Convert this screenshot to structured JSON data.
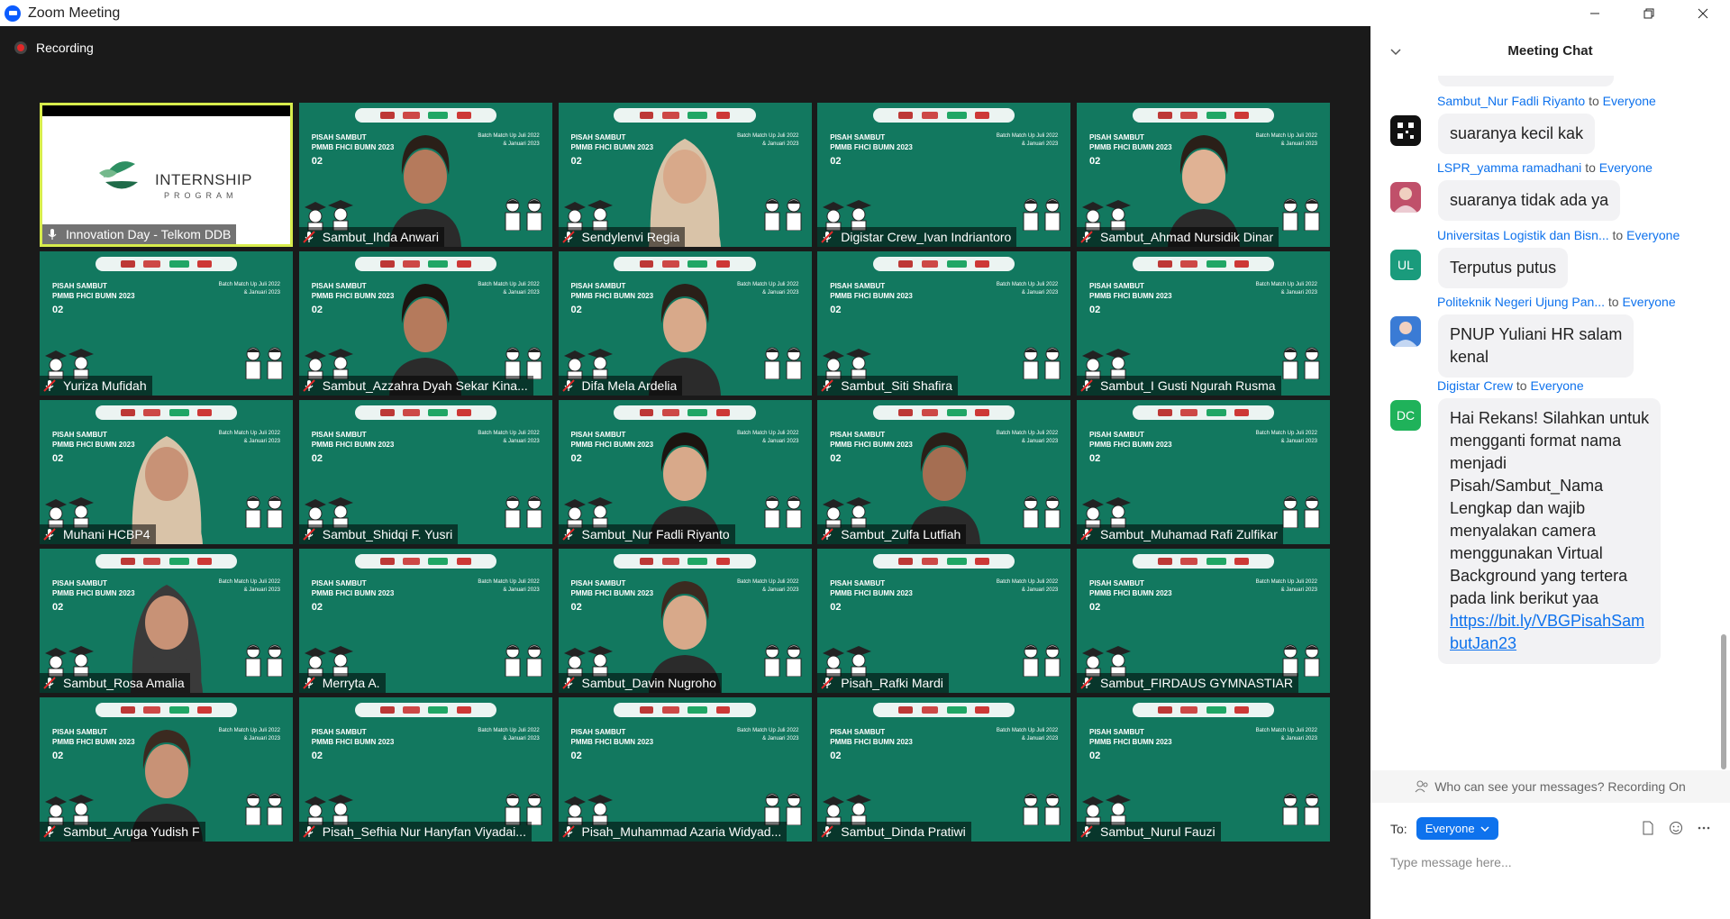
{
  "window": {
    "title": "Zoom Meeting"
  },
  "stage": {
    "recording_label": "Recording"
  },
  "tile_text": {
    "headline": "PISAH SAMBUT\nPMMB FHCI BUMN 2023",
    "batch": "Batch Match Up Juli 2022\n& Januari 2023",
    "date": "02"
  },
  "participants": [
    {
      "name": "Innovation Day - Telkom DDB",
      "type": "slide",
      "active": true,
      "mic": "unmuted"
    },
    {
      "name": "Sambut_Ihda Anwari",
      "type": "person",
      "mic": "muted"
    },
    {
      "name": "Sendylenvi Regia",
      "type": "person",
      "mic": "muted"
    },
    {
      "name": "Digistar Crew_Ivan Indriantoro",
      "type": "background",
      "mic": "muted"
    },
    {
      "name": "Sambut_Ahmad Nursidik Dinar",
      "type": "person",
      "mic": "muted"
    },
    {
      "name": "Yuriza Mufidah",
      "type": "background",
      "mic": "muted"
    },
    {
      "name": "Sambut_Azzahra Dyah Sekar Kina...",
      "type": "person",
      "mic": "muted"
    },
    {
      "name": "Difa Mela Ardelia",
      "type": "person",
      "mic": "muted"
    },
    {
      "name": "Sambut_Siti Shafira",
      "type": "background",
      "mic": "muted"
    },
    {
      "name": "Sambut_I Gusti Ngurah Rusma",
      "type": "background",
      "mic": "muted"
    },
    {
      "name": "Muhani HCBP4",
      "type": "person",
      "mic": "muted"
    },
    {
      "name": "Sambut_Shidqi F. Yusri",
      "type": "background",
      "mic": "muted"
    },
    {
      "name": "Sambut_Nur Fadli Riyanto",
      "type": "person",
      "mic": "muted"
    },
    {
      "name": "Sambut_Zulfa Lutfiah",
      "type": "person",
      "mic": "muted"
    },
    {
      "name": "Sambut_Muhamad Rafi Zulfikar",
      "type": "background",
      "mic": "muted"
    },
    {
      "name": "Sambut_Rosa Amalia",
      "type": "person",
      "mic": "muted"
    },
    {
      "name": "Merryta A.",
      "type": "background",
      "mic": "muted"
    },
    {
      "name": "Sambut_Davin Nugroho",
      "type": "person",
      "mic": "muted"
    },
    {
      "name": "Pisah_Rafki Mardi",
      "type": "background",
      "mic": "muted"
    },
    {
      "name": "Sambut_FIRDAUS GYMNASTIAR",
      "type": "background",
      "mic": "muted"
    },
    {
      "name": "Sambut_Aruga Yudish F",
      "type": "person",
      "mic": "muted"
    },
    {
      "name": "Pisah_Sefhia Nur Hanyfan Viyadai...",
      "type": "background",
      "mic": "muted"
    },
    {
      "name": "Pisah_Muhammad Azaria Widyad...",
      "type": "background",
      "mic": "muted"
    },
    {
      "name": "Sambut_Dinda Pratiwi",
      "type": "background",
      "mic": "muted"
    },
    {
      "name": "Sambut_Nurul Fauzi",
      "type": "background",
      "mic": "muted"
    }
  ],
  "slide": {
    "title": "INTERNSHIP",
    "subtitle": "PROGRAM"
  },
  "chat": {
    "title": "Meeting Chat",
    "to_word": "to",
    "messages": [
      {
        "sender": "Sambut_Nur Fadli Riyanto",
        "recipient": "Everyone",
        "avatar_icon": "qr-avatar-icon",
        "avatar_color": "#111111",
        "text": "suaranya kecil kak"
      },
      {
        "sender": "LSPR_yamma ramadhani",
        "recipient": "Everyone",
        "avatar_icon": "photo-avatar-icon",
        "avatar_color": "#c0506a",
        "text": "suaranya tidak ada ya"
      },
      {
        "sender": "Universitas Logistik dan Bisn...",
        "recipient": "Everyone",
        "avatar_initials": "UL",
        "avatar_color": "#1a9b7c",
        "text": "Terputus putus"
      },
      {
        "sender": "Politeknik Negeri Ujung Pan...",
        "recipient": "Everyone",
        "avatar_icon": "photo-avatar-icon",
        "avatar_color": "#3a7bd5",
        "text": "PNUP Yuliani HR salam\nkenal"
      },
      {
        "sender": "Digistar Crew",
        "recipient": "Everyone",
        "avatar_initials": "DC",
        "avatar_color": "#1fb25a",
        "text": "Hai Rekans! Silahkan untuk\nmengganti format nama\nmenjadi\nPisah/Sambut_Nama\nLengkap dan wajib\nmenyalakan camera\nmenggunakan Virtual\nBackground yang tertera\npada link berikut yaa",
        "link": "https://bit.ly/VBGPisahSam\nbutJan23"
      }
    ],
    "privacy_note": "Who can see your messages? Recording On",
    "to_label": "To:",
    "recipient_select": "Everyone",
    "input_placeholder": "Type message here..."
  },
  "colors": {
    "accent": "#0e72ed",
    "tile_bg": "#12785f",
    "active_border": "#d7ec4c",
    "muted_icon": "#e02828"
  }
}
